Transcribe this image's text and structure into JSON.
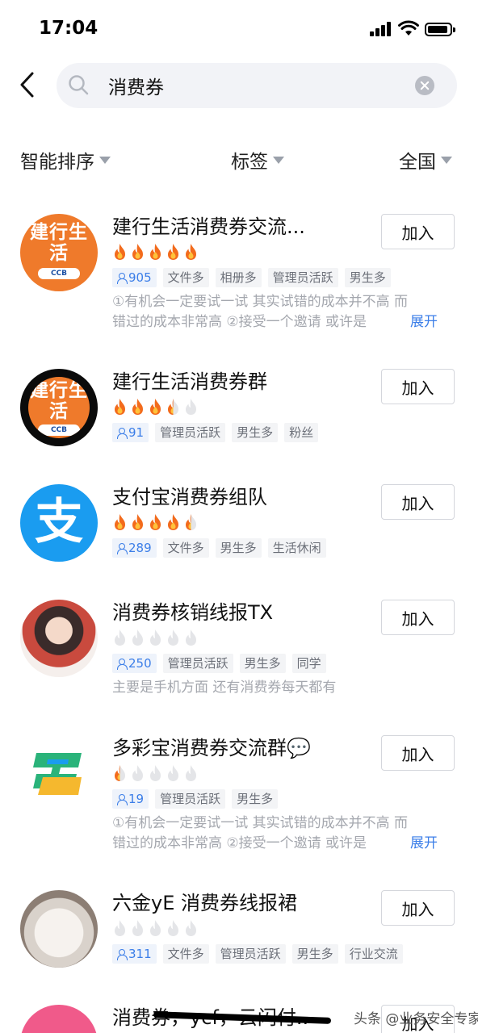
{
  "status_bar": {
    "time": "17:04"
  },
  "search": {
    "value": "消费券"
  },
  "filters": {
    "sort": "智能排序",
    "tags": "标签",
    "region": "全国"
  },
  "join_label": "加入",
  "expand_label": "展开",
  "groups": [
    {
      "name": "建行生活消费券交流...",
      "avatar_text": "建行生活",
      "avatar_badge": "CCB",
      "flames": [
        1,
        1,
        1,
        1,
        1
      ],
      "members": "905",
      "tags": [
        "文件多",
        "相册多",
        "管理员活跃",
        "男生多"
      ],
      "desc": [
        "①有机会一定要试一试 其实试错的成本并不高 而",
        "错过的成本非常高 ②接受一个邀请 或许是"
      ],
      "expandable": true
    },
    {
      "name": "建行生活消费券群",
      "avatar_text": "建行生活",
      "avatar_badge": "CCB",
      "flames": [
        1,
        1,
        1,
        0.5,
        0
      ],
      "members": "91",
      "tags": [
        "管理员活跃",
        "男生多",
        "粉丝"
      ],
      "desc": [],
      "expandable": false
    },
    {
      "name": "支付宝消费券组队",
      "avatar_text": "支",
      "flames": [
        1,
        1,
        1,
        1,
        0.5
      ],
      "members": "289",
      "tags": [
        "文件多",
        "男生多",
        "生活休闲"
      ],
      "desc": [],
      "expandable": false
    },
    {
      "name": "消费券核销线报TX",
      "flames": [
        0,
        0,
        0,
        0,
        0
      ],
      "members": "250",
      "tags": [
        "管理员活跃",
        "男生多",
        "同学"
      ],
      "desc": [
        "主要是手机方面 还有消费券每天都有"
      ],
      "expandable": false
    },
    {
      "name": "多彩宝消费券交流群💬",
      "flames": [
        0.5,
        0,
        0,
        0,
        0
      ],
      "members": "19",
      "tags": [
        "管理员活跃",
        "男生多"
      ],
      "desc": [
        "①有机会一定要试一试 其实试错的成本并不高 而",
        "错过的成本非常高 ②接受一个邀请 或许是"
      ],
      "expandable": true
    },
    {
      "name": "六金yE 消费券线报裙",
      "flames": [
        0,
        0,
        0,
        0,
        0
      ],
      "members": "311",
      "tags": [
        "文件多",
        "管理员活跃",
        "男生多",
        "行业交流"
      ],
      "desc": [],
      "expandable": false
    },
    {
      "name": "消费券，ycf，云闪付..",
      "flames": [],
      "members": "",
      "tags": [],
      "desc": [],
      "expandable": false
    }
  ],
  "watermark": "头条 @业务安全专家",
  "colors": {
    "accent": "#3b7ee8",
    "flame_active": "#f36b1c",
    "flame_inactive": "#e4e5e8"
  }
}
